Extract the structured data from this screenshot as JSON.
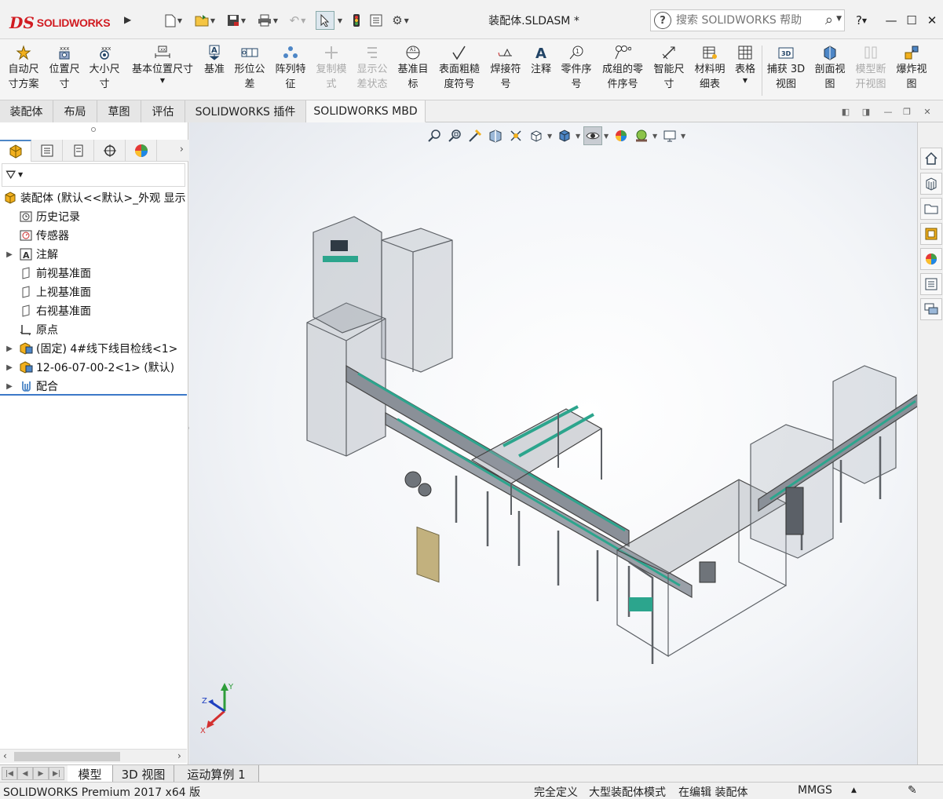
{
  "app": {
    "logo_text": "SOLIDWORKS",
    "doc_title": "装配体.SLDASM *"
  },
  "search": {
    "placeholder": "搜索 SOLIDWORKS 帮助"
  },
  "ribbon": {
    "items": [
      {
        "label": "自动尺\n寸方案",
        "enabled": true,
        "icon": "auto-dimension-scheme-icon"
      },
      {
        "label": "位置尺\n寸",
        "enabled": true,
        "icon": "location-dimension-icon"
      },
      {
        "label": "大小尺\n寸",
        "enabled": true,
        "icon": "size-dimension-icon"
      },
      {
        "label": "基本位置尺寸",
        "enabled": true,
        "icon": "basic-location-dimension-icon"
      },
      {
        "label": "基准",
        "enabled": true,
        "icon": "datum-icon"
      },
      {
        "label": "形位公\n差",
        "enabled": true,
        "icon": "geometric-tolerance-icon"
      },
      {
        "label": "阵列特\n征",
        "enabled": true,
        "icon": "pattern-feature-icon"
      },
      {
        "label": "复制模\n式",
        "enabled": false,
        "icon": "copy-scheme-icon"
      },
      {
        "label": "显示公\n差状态",
        "enabled": false,
        "icon": "show-tolerance-status-icon"
      },
      {
        "label": "基准目\n标",
        "enabled": true,
        "icon": "datum-target-icon"
      },
      {
        "label": "表面粗糙\n度符号",
        "enabled": true,
        "icon": "surface-finish-icon"
      },
      {
        "label": "焊接符\n号",
        "enabled": true,
        "icon": "weld-symbol-icon"
      },
      {
        "label": "注释",
        "enabled": true,
        "icon": "note-icon"
      },
      {
        "label": "零件序\n号",
        "enabled": true,
        "icon": "balloon-icon"
      },
      {
        "label": "成组的零\n件序号",
        "enabled": true,
        "icon": "stacked-balloon-icon"
      },
      {
        "label": "智能尺\n寸",
        "enabled": true,
        "icon": "smart-dimension-icon"
      },
      {
        "label": "材料明\n细表",
        "enabled": true,
        "icon": "bom-icon"
      },
      {
        "label": "表格",
        "enabled": true,
        "icon": "table-icon"
      },
      {
        "label": "捕获 3D\n视图",
        "enabled": true,
        "icon": "capture-3d-view-icon"
      },
      {
        "label": "剖面视\n图",
        "enabled": true,
        "icon": "section-view-icon"
      },
      {
        "label": "模型断\n开视图",
        "enabled": false,
        "icon": "model-break-view-icon"
      },
      {
        "label": "爆炸视\n图",
        "enabled": true,
        "icon": "exploded-view-icon"
      }
    ]
  },
  "tabs": [
    {
      "label": "装配体",
      "active": false
    },
    {
      "label": "布局",
      "active": false
    },
    {
      "label": "草图",
      "active": false
    },
    {
      "label": "评估",
      "active": false
    },
    {
      "label": "SOLIDWORKS 插件",
      "active": false
    },
    {
      "label": "SOLIDWORKS MBD",
      "active": true
    }
  ],
  "tree": {
    "items": [
      {
        "label": "装配体 (默认<<默认>_外观 显示",
        "level": 0,
        "expandable": false,
        "icon": "assembly-icon"
      },
      {
        "label": "历史记录",
        "level": 1,
        "expandable": false,
        "icon": "history-icon"
      },
      {
        "label": "传感器",
        "level": 1,
        "expandable": false,
        "icon": "sensor-icon"
      },
      {
        "label": "注解",
        "level": 1,
        "expandable": true,
        "icon": "annotation-icon"
      },
      {
        "label": "前视基准面",
        "level": 1,
        "expandable": false,
        "icon": "plane-icon"
      },
      {
        "label": "上视基准面",
        "level": 1,
        "expandable": false,
        "icon": "plane-icon"
      },
      {
        "label": "右视基准面",
        "level": 1,
        "expandable": false,
        "icon": "plane-icon"
      },
      {
        "label": "原点",
        "level": 1,
        "expandable": false,
        "icon": "origin-icon"
      },
      {
        "label": "(固定) 4#线下线目检线<1>",
        "level": 1,
        "expandable": true,
        "icon": "subassembly-icon"
      },
      {
        "label": "12-06-07-00-2<1> (默认)",
        "level": 1,
        "expandable": true,
        "icon": "subassembly-icon"
      },
      {
        "label": "配合",
        "level": 1,
        "expandable": true,
        "icon": "mates-icon"
      }
    ]
  },
  "triad": {
    "x": "X",
    "y": "Y",
    "z": "Z"
  },
  "bottom_tabs": [
    {
      "label": "模型",
      "active": true
    },
    {
      "label": "3D 视图",
      "active": false
    },
    {
      "label": "运动算例 1",
      "active": false
    }
  ],
  "status": {
    "product": "SOLIDWORKS Premium 2017 x64 版",
    "definition": "完全定义",
    "mode": "大型装配体模式",
    "editing": "在编辑 装配体",
    "units": "MMGS"
  },
  "colors": {
    "brand": "#d11b21",
    "accent": "#3c78c8",
    "frame": "#8a8e94",
    "conveyor": "#2ca58d"
  }
}
